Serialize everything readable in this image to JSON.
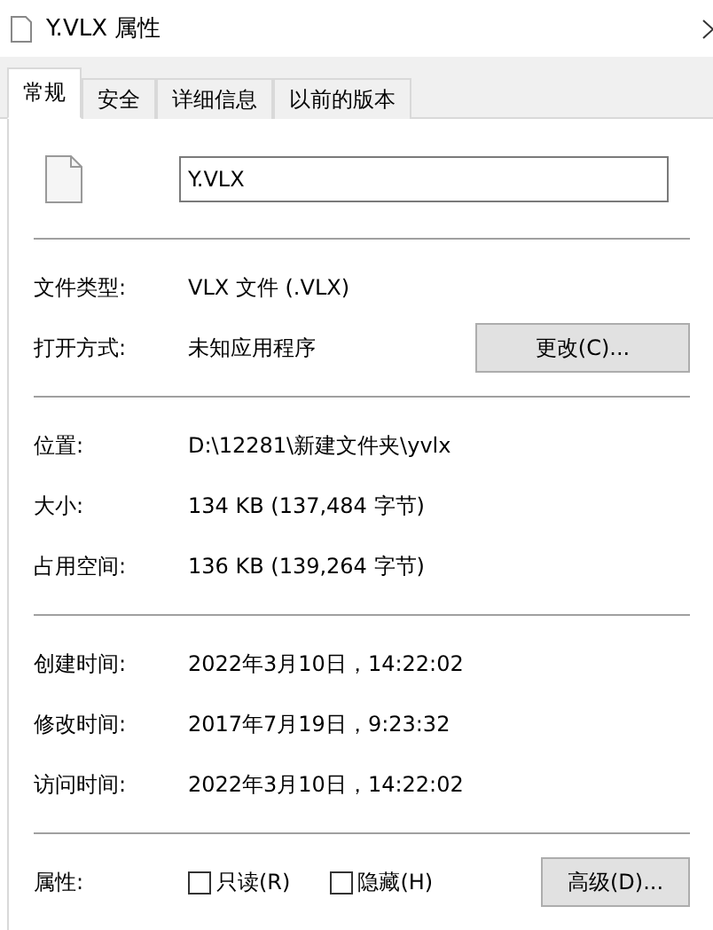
{
  "window": {
    "title": "Y.VLX 属性"
  },
  "tabs": [
    {
      "label": "常规",
      "selected": true
    },
    {
      "label": "安全",
      "selected": false
    },
    {
      "label": "详细信息",
      "selected": false
    },
    {
      "label": "以前的版本",
      "selected": false
    }
  ],
  "name_field": {
    "value": "Y.VLX"
  },
  "sections": [
    [
      {
        "label": "文件类型:",
        "value": "VLX 文件 (.VLX)"
      },
      {
        "label": "打开方式:",
        "value": "未知应用程序",
        "button": "更改(C)..."
      }
    ],
    [
      {
        "label": "位置:",
        "value": "D:\\12281\\新建文件夹\\yvlx"
      },
      {
        "label": "大小:",
        "value": "134 KB (137,484 字节)"
      },
      {
        "label": "占用空间:",
        "value": "136 KB (139,264 字节)"
      }
    ],
    [
      {
        "label": "创建时间:",
        "value": "2022年3月10日，14:22:02"
      },
      {
        "label": "修改时间:",
        "value": "2017年7月19日，9:23:32"
      },
      {
        "label": "访问时间:",
        "value": "2022年3月10日，14:22:02"
      }
    ]
  ],
  "attributes": {
    "label": "属性:",
    "checkboxes": [
      {
        "label": "只读(R)",
        "checked": false
      },
      {
        "label": "隐藏(H)",
        "checked": false
      }
    ],
    "button": "高级(D)..."
  }
}
